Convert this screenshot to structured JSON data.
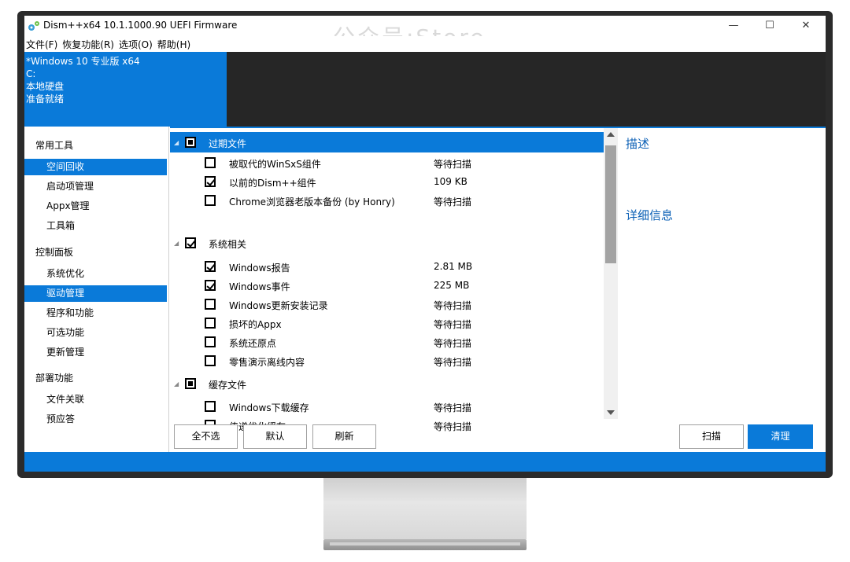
{
  "window": {
    "title": "Dism++x64 10.1.1000.90 UEFI Firmware",
    "watermark": "公众号:Store",
    "minimize_glyph": "—",
    "maximize_glyph": "☐",
    "close_glyph": "✕"
  },
  "menu": [
    "文件(F)",
    "恢复功能(R)",
    "选项(O)",
    "帮助(H)"
  ],
  "header": {
    "os_name": "*Windows 10 专业版 x64",
    "drive": "C:",
    "disk_type": "本地硬盘",
    "status": "准备就绪"
  },
  "sidebar": {
    "groups": [
      {
        "label": "常用工具",
        "items": [
          "空间回收",
          "启动项管理",
          "Appx管理",
          "工具箱"
        ]
      },
      {
        "label": "控制面板",
        "items": [
          "系统优化",
          "驱动管理",
          "程序和功能",
          "可选功能",
          "更新管理"
        ]
      },
      {
        "label": "部署功能",
        "items": [
          "文件关联",
          "预应答"
        ]
      }
    ],
    "active_items": [
      "空间回收",
      "驱动管理"
    ]
  },
  "list": {
    "groups": [
      {
        "label": "过期文件",
        "state": "indeterminate",
        "items": [
          {
            "name": "被取代的WinSxS组件",
            "size": "等待扫描",
            "checked": false
          },
          {
            "name": "以前的Dism++组件",
            "size": "109 KB",
            "checked": true
          },
          {
            "name": "Chrome浏览器老版本备份 (by Honry)",
            "size": "等待扫描",
            "checked": false
          }
        ]
      },
      {
        "label": "系统相关",
        "state": "checked",
        "items": [
          {
            "name": "Windows报告",
            "size": "2.81 MB",
            "checked": true
          },
          {
            "name": "Windows事件",
            "size": "225 MB",
            "checked": true
          },
          {
            "name": "Windows更新安装记录",
            "size": "等待扫描",
            "checked": false
          },
          {
            "name": "损坏的Appx",
            "size": "等待扫描",
            "checked": false
          },
          {
            "name": "系统还原点",
            "size": "等待扫描",
            "checked": false
          },
          {
            "name": "零售演示离线内容",
            "size": "等待扫描",
            "checked": false
          }
        ]
      },
      {
        "label": "缓存文件",
        "state": "indeterminate",
        "items": [
          {
            "name": "Windows下载缓存",
            "size": "等待扫描",
            "checked": false
          },
          {
            "name": "传递优化缓存",
            "size": "等待扫描",
            "checked": false
          }
        ]
      }
    ]
  },
  "panel": {
    "description_title": "描述",
    "details_title": "详细信息"
  },
  "buttons": {
    "select_none": "全不选",
    "default": "默认",
    "refresh": "刷新",
    "scan": "扫描",
    "clean": "清理"
  },
  "colors": {
    "accent": "#0a7ad9",
    "header_dark": "#262626",
    "panel_title": "#0a5fb5"
  }
}
